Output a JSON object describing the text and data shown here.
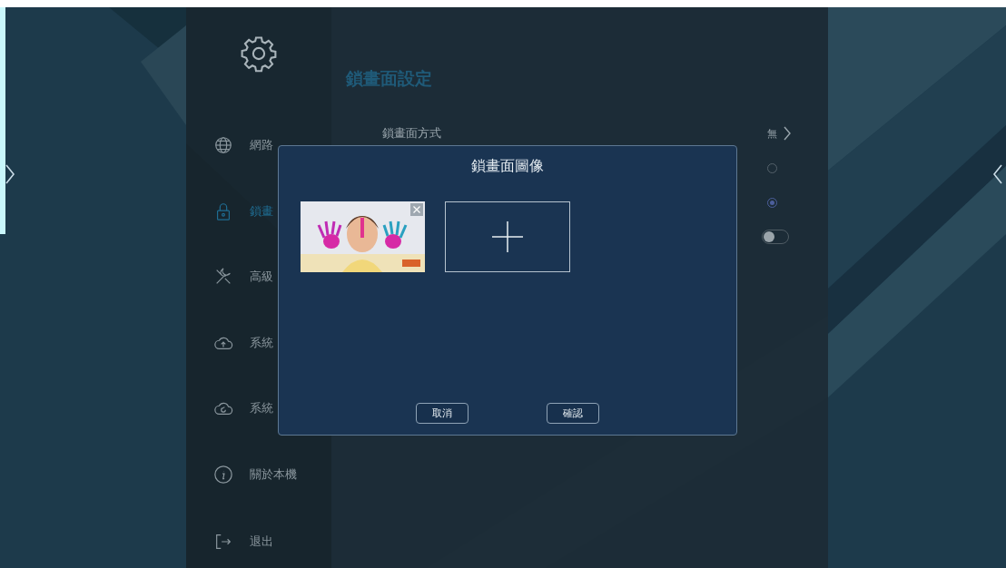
{
  "page_title": "鎖畫面設定",
  "sidebar": {
    "items": [
      {
        "label": "網路",
        "selected": false
      },
      {
        "label": "鎖畫",
        "selected": true
      },
      {
        "label": "高級",
        "selected": false
      },
      {
        "label": "系統",
        "selected": false
      },
      {
        "label": "系統",
        "selected": false
      },
      {
        "label": "關於本機",
        "selected": false
      }
    ],
    "exit": "退出"
  },
  "settings": [
    {
      "kind": "value",
      "label": "鎖畫面方式",
      "value": "無"
    },
    {
      "kind": "radio",
      "selected": false
    },
    {
      "kind": "radio",
      "selected": true
    },
    {
      "kind": "toggle",
      "on": false
    }
  ],
  "dialog": {
    "title": "鎖畫面圖像",
    "buttons": [
      "取消",
      "確認"
    ]
  }
}
